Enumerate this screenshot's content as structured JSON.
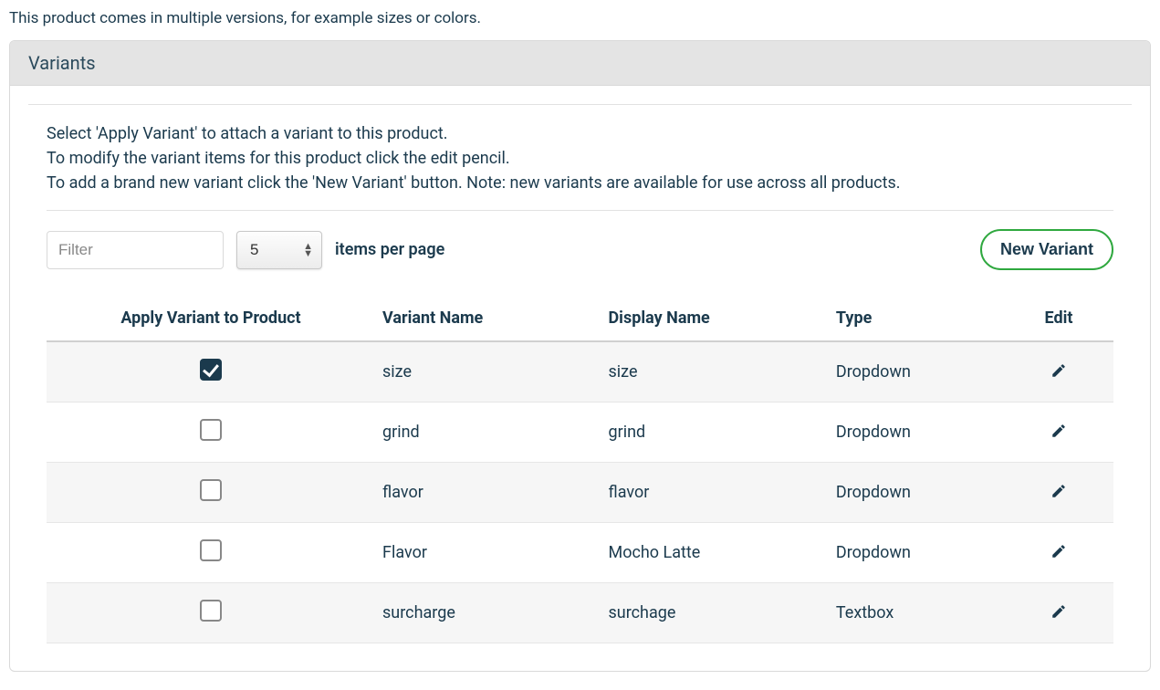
{
  "intro_text": "This product comes in multiple versions, for example sizes or colors.",
  "panel": {
    "title": "Variants",
    "instructions": {
      "line1": "Select 'Apply Variant' to attach a variant to this product.",
      "line2": "To modify the variant items for this product click the edit pencil.",
      "line3": "To add a brand new variant click the 'New Variant' button. Note: new variants are available for use across all products."
    }
  },
  "controls": {
    "filter_placeholder": "Filter",
    "items_per_page_value": "5",
    "items_per_page_label": "items per page",
    "new_variant_label": "New Variant"
  },
  "table": {
    "headers": {
      "apply": "Apply Variant to Product",
      "variant_name": "Variant Name",
      "display_name": "Display Name",
      "type": "Type",
      "edit": "Edit"
    },
    "rows": [
      {
        "applied": true,
        "variant_name": "size",
        "display_name": "size",
        "type": "Dropdown"
      },
      {
        "applied": false,
        "variant_name": "grind",
        "display_name": "grind",
        "type": "Dropdown"
      },
      {
        "applied": false,
        "variant_name": "flavor",
        "display_name": "flavor",
        "type": "Dropdown"
      },
      {
        "applied": false,
        "variant_name": "Flavor",
        "display_name": "Mocho Latte",
        "type": "Dropdown"
      },
      {
        "applied": false,
        "variant_name": "surcharge",
        "display_name": "surchage",
        "type": "Textbox"
      }
    ]
  }
}
